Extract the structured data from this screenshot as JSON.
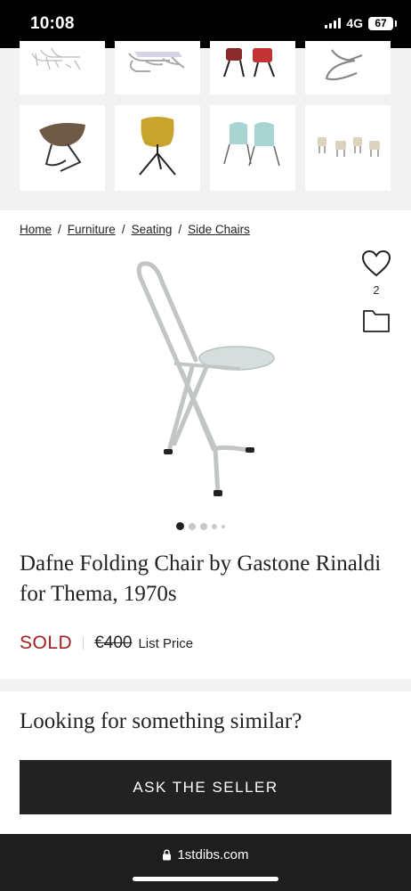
{
  "status_bar": {
    "time": "10:08",
    "network": "4G",
    "battery": "67"
  },
  "thumbnails": [
    {
      "name": "chair-thumb-stacked-white"
    },
    {
      "name": "chair-thumb-stacked-purple"
    },
    {
      "name": "chair-thumb-red-seats"
    },
    {
      "name": "chair-thumb-cantilever"
    },
    {
      "name": "chair-thumb-brown-mesh"
    },
    {
      "name": "chair-thumb-yellow-wicker"
    },
    {
      "name": "chair-thumb-mint-pair"
    },
    {
      "name": "chair-thumb-rattan-set"
    }
  ],
  "breadcrumb": {
    "items": [
      "Home",
      "Furniture",
      "Seating",
      "Side Chairs"
    ],
    "separator": "/"
  },
  "favorites": {
    "count": "2",
    "icon": "heart-icon"
  },
  "carousel": {
    "total_dots": 5,
    "active_index": 0
  },
  "product": {
    "title": "Dafne Folding Chair by Gastone Rinaldi for Thema, 1970s",
    "status": "SOLD",
    "price": "€400",
    "price_label": "List Price"
  },
  "similar": {
    "heading": "Looking for something similar?",
    "button_label": "ASK THE SELLER"
  },
  "browser": {
    "url": "1stdibs.com",
    "lock_icon": "lock-icon"
  },
  "colors": {
    "sold": "#a31f1f",
    "button_bg": "#222222",
    "section_bg": "#f2f2f2"
  }
}
